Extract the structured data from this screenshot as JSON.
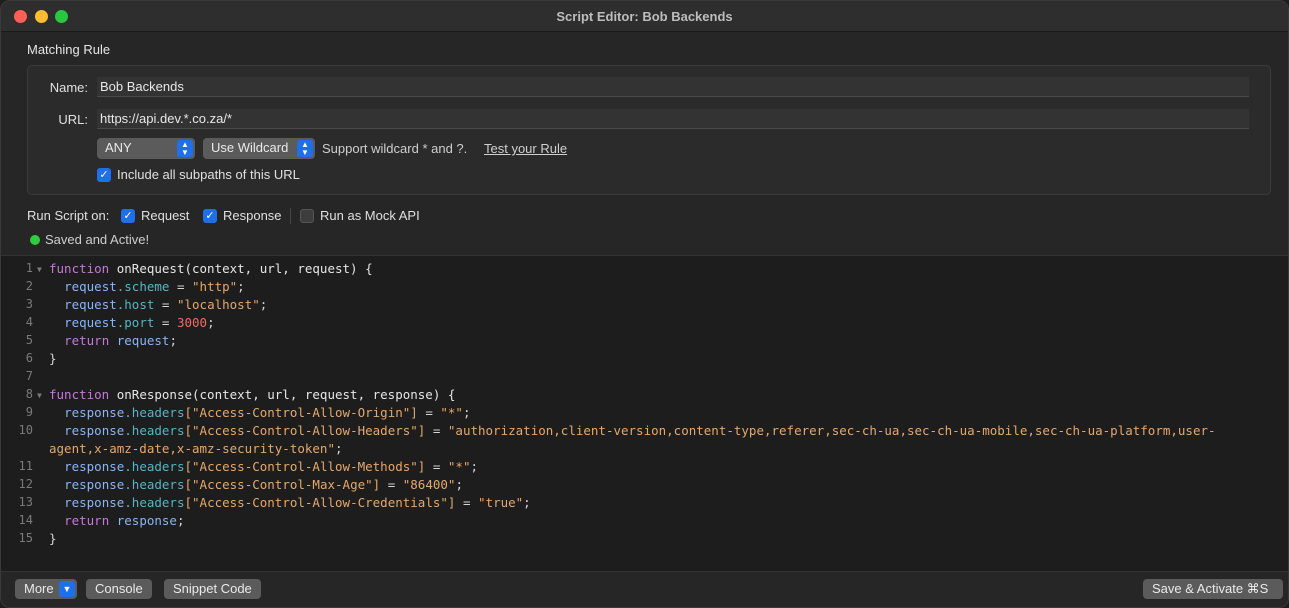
{
  "window": {
    "title": "Script Editor: Bob Backends"
  },
  "matching_rule": {
    "section_label": "Matching Rule",
    "name_label": "Name:",
    "name_value": "Bob Backends",
    "url_label": "URL:",
    "url_value": "https://api.dev.*.co.za/*",
    "method": "ANY",
    "match_type": "Use Wildcard",
    "help_text": "Support wildcard * and ?.",
    "test_link": "Test your Rule",
    "include_subpaths_label": "Include all subpaths of this URL",
    "include_subpaths_checked": true
  },
  "run_script": {
    "label": "Run Script on:",
    "request_label": "Request",
    "request_checked": true,
    "response_label": "Response",
    "response_checked": true,
    "mock_label": "Run as Mock API",
    "mock_checked": false
  },
  "status": {
    "text": "Saved and Active!",
    "color": "#2ecc40"
  },
  "editor": {
    "line_numbers": [
      "1",
      "2",
      "3",
      "4",
      "5",
      "6",
      "7",
      "8",
      "9",
      "10",
      "11",
      "12",
      "13",
      "14",
      "15"
    ],
    "code": {
      "l1_kw": "function",
      "l1_rest": " onRequest(context, url, request) {",
      "l2_obj": "request",
      "l2_prop": ".scheme",
      "l2_eq": " = ",
      "l2_val": "\"http\"",
      "l3_obj": "request",
      "l3_prop": ".host",
      "l3_eq": " = ",
      "l3_val": "\"localhost\"",
      "l4_obj": "request",
      "l4_prop": ".port",
      "l4_eq": " = ",
      "l4_val": "3000",
      "l5_kw": "return",
      "l5_obj": "request",
      "l6": "}",
      "l8_kw": "function",
      "l8_rest": " onResponse(context, url, request, response) {",
      "l9_obj": "response",
      "l9_prop": ".headers",
      "l9_key": "[\"Access-Control-Allow-Origin\"]",
      "l9_eq": " = ",
      "l9_val": "\"*\"",
      "l10_obj": "response",
      "l10_prop": ".headers",
      "l10_key": "[\"Access-Control-Allow-Headers\"]",
      "l10_eq": " = ",
      "l10_val_a": "\"authorization,client-version,content-type,referer,sec-ch-ua,sec-ch-ua-mobile,sec-ch-ua-platform,user-",
      "l10_val_b": "agent,x-amz-date,x-amz-security-token\"",
      "l11_obj": "response",
      "l11_prop": ".headers",
      "l11_key": "[\"Access-Control-Allow-Methods\"]",
      "l11_eq": " = ",
      "l11_val": "\"*\"",
      "l12_obj": "response",
      "l12_prop": ".headers",
      "l12_key": "[\"Access-Control-Max-Age\"]",
      "l12_eq": " = ",
      "l12_val": "\"86400\"",
      "l13_obj": "response",
      "l13_prop": ".headers",
      "l13_key": "[\"Access-Control-Allow-Credentials\"]",
      "l13_eq": " = ",
      "l13_val": "\"true\"",
      "l14_kw": "return",
      "l14_obj": "response",
      "l15": "}"
    }
  },
  "footer": {
    "more_label": "More",
    "console_label": "Console",
    "snippet_label": "Snippet Code",
    "save_label": "Save & Activate ⌘S"
  },
  "icons": {
    "close": "close-traffic-light",
    "minimize": "minimize-traffic-light",
    "maximize": "maximize-traffic-light",
    "popup_chevron": "updown-chevron-icon",
    "check": "checkmark-icon",
    "fold": "fold-triangle-icon"
  }
}
